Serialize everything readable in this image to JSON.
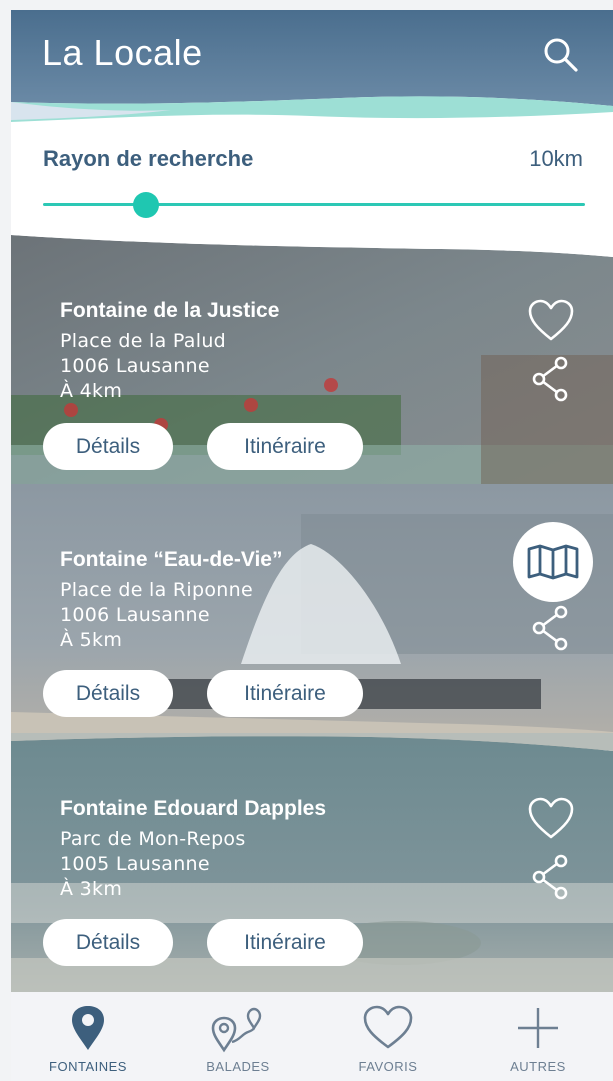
{
  "header": {
    "logo": "La Locale",
    "search_icon": "search-icon"
  },
  "radius": {
    "label": "Rayon de recherche",
    "value": "10km",
    "slider_fraction": 0.19
  },
  "fountains": [
    {
      "title": "Fontaine de la Justice",
      "place": "Place de la Palud",
      "city": "1006 Lausanne",
      "distance": "À 4km",
      "details_label": "Détails",
      "route_label": "Itinéraire",
      "top_icon": "heart-icon"
    },
    {
      "title": "Fontaine “Eau-de-Vie”",
      "place": "Place de la Riponne",
      "city": "1006 Lausanne",
      "distance": "À 5km",
      "details_label": "Détails",
      "route_label": "Itinéraire",
      "top_icon": "map-icon"
    },
    {
      "title": "Fontaine Edouard Dapples",
      "place": "Parc de Mon-Repos",
      "city": "1005 Lausanne",
      "distance": "À 3km",
      "details_label": "Détails",
      "route_label": "Itinéraire",
      "top_icon": "heart-icon"
    }
  ],
  "nav": [
    {
      "label": "FONTAINES",
      "icon": "location-pin-icon",
      "active": true
    },
    {
      "label": "BALADES",
      "icon": "route-icon",
      "active": false
    },
    {
      "label": "FAVORIS",
      "icon": "heart-icon",
      "active": false
    },
    {
      "label": "AUTRES",
      "icon": "plus-icon",
      "active": false
    }
  ],
  "colors": {
    "header": "#4a6e8e",
    "accent": "#2cc8b5",
    "text_dark": "#3d5f7d"
  }
}
